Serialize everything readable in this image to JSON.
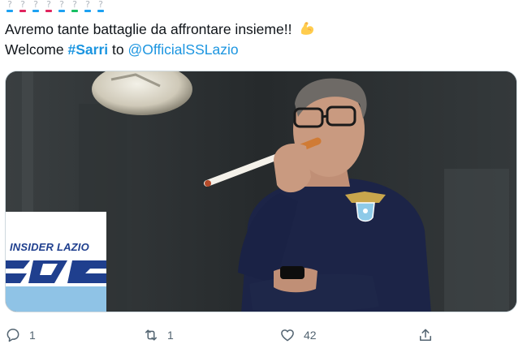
{
  "tweet": {
    "line1": "Avremo tante battaglie da affrontare insieme!!",
    "line2_prefix": "Welcome",
    "hashtag": "#Sarri",
    "line2_mid": "to",
    "mention": "@OfficialSSLazio",
    "emoji_name": "flexed-biceps-emoji"
  },
  "media": {
    "logo_text": "INSIDER LAZIO"
  },
  "actions": {
    "reply_count": "1",
    "retweet_count": "1",
    "like_count": "42",
    "share_count": ""
  },
  "colors": {
    "link": "#1b95e0",
    "icon": "#536471",
    "logo_blue": "#1f3f8e"
  }
}
